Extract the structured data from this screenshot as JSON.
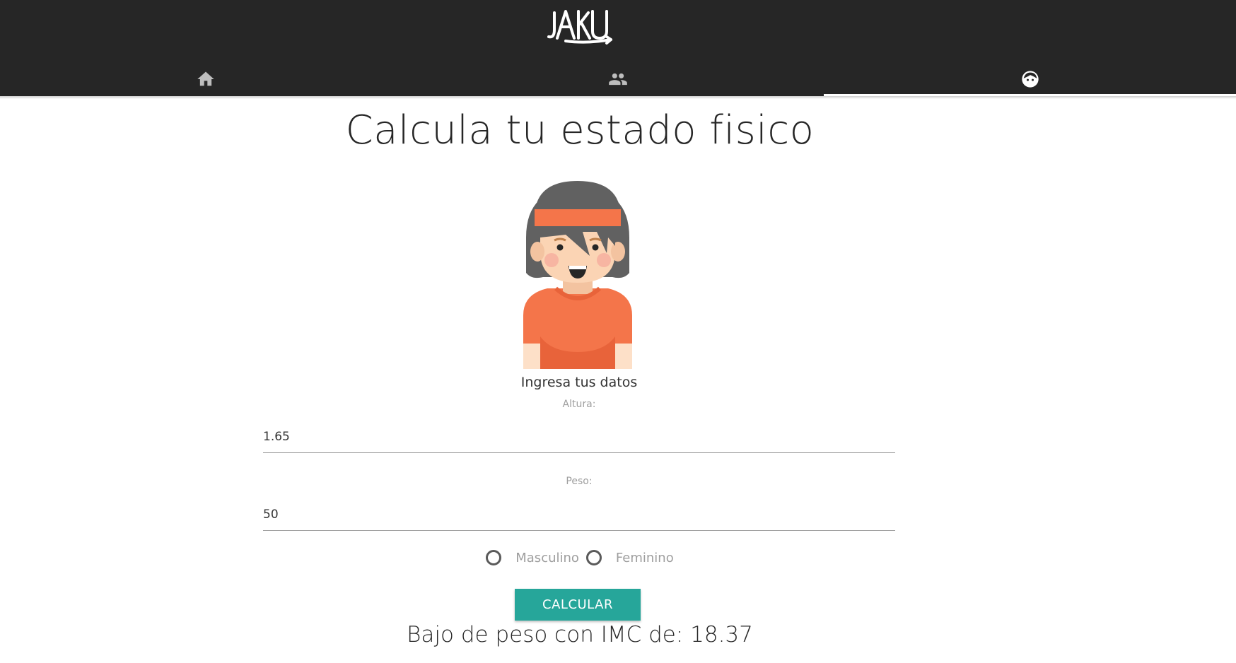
{
  "header": {
    "logo_text": "JAKU",
    "tabs": [
      {
        "icon": "home-icon"
      },
      {
        "icon": "people-icon"
      },
      {
        "icon": "face-icon",
        "active": true
      }
    ]
  },
  "main": {
    "title": "Calcula tu estado fisico",
    "subtitle": "Ingresa tus datos",
    "height_label": "Altura:",
    "height_value": "1.65",
    "weight_label": "Peso:",
    "weight_value": "50",
    "gender_options": [
      "Masculino",
      "Feminino"
    ],
    "calculate_label": "CALCULAR",
    "result": "Bajo de peso con IMC de: 18.37"
  },
  "colors": {
    "header_bg": "#262626",
    "accent": "#26a69a",
    "avatar_shirt": "#f4754a",
    "avatar_hair": "#616161"
  }
}
